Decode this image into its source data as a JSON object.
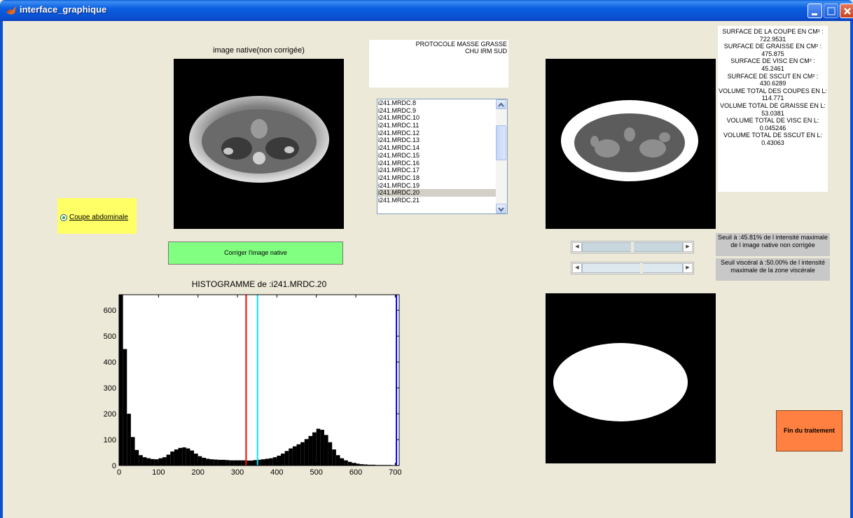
{
  "window": {
    "title": "interface_graphique"
  },
  "native_image": {
    "caption": "image native(non corrigée)"
  },
  "protocol": {
    "line1": "PROTOCOLE MASSE GRASSE",
    "line2": "CHU IRM SUD"
  },
  "file_list": {
    "items": [
      "i241.MRDC.8",
      "i241.MRDC.9",
      "i241.MRDC.10",
      "i241.MRDC.11",
      "i241.MRDC.12",
      "i241.MRDC.13",
      "i241.MRDC.14",
      "i241.MRDC.15",
      "i241.MRDC.16",
      "i241.MRDC.17",
      "i241.MRDC.18",
      "i241.MRDC.19",
      "i241.MRDC.20",
      "i241.MRDC.21"
    ],
    "selected": "i241.MRDC.20"
  },
  "radio": {
    "label": "Coupe abdominale",
    "checked": true
  },
  "correct_button": {
    "label": "Corriger l'image native"
  },
  "stats": {
    "lines": [
      "SURFACE DE LA COUPE EN CM² :",
      "722.9531",
      "SURFACE DE GRAISSE EN CM² :",
      "475.875",
      "SURFACE DE VISC EN CM² :",
      "45.2461",
      "SURFACE DE SSCUT EN CM² :",
      "430.6289",
      "VOLUME TOTAL DES COUPES EN L:",
      "114.771",
      "VOLUME TOTAL DE GRAISSE EN L:",
      "53.0381",
      "VOLUME TOTAL DE VISC EN L:",
      "0.045246",
      "VOLUME TOTAL DE SSCUT EN L:",
      "0.43063"
    ]
  },
  "thresholds": {
    "seuil1": "Seuil à :45.81% de l intensité maximale de l image native non corrigée",
    "seuil2": "Seuil viscéral à :50.00% de l intensité maximale de la zone viscérale",
    "slider1_value": 0.5,
    "slider2_value": 0.59
  },
  "finish_button": {
    "label": "Fin du traitement"
  },
  "chart_data": {
    "type": "bar",
    "title": "HISTOGRAMME de :i241.MRDC.20",
    "xlabel": "",
    "ylabel": "",
    "xlim": [
      0,
      710
    ],
    "ylim": [
      0,
      660
    ],
    "xticks": [
      0,
      100,
      200,
      300,
      400,
      500,
      600,
      700
    ],
    "yticks": [
      0,
      100,
      200,
      300,
      400,
      500,
      600
    ],
    "bin_width": 10,
    "x": [
      0,
      10,
      20,
      30,
      40,
      50,
      60,
      70,
      80,
      90,
      100,
      110,
      120,
      130,
      140,
      150,
      160,
      170,
      180,
      190,
      200,
      210,
      220,
      230,
      240,
      250,
      260,
      270,
      280,
      290,
      300,
      310,
      320,
      330,
      340,
      350,
      360,
      370,
      380,
      390,
      400,
      410,
      420,
      430,
      440,
      450,
      460,
      470,
      480,
      490,
      500,
      510,
      520,
      530,
      540,
      550,
      560,
      570,
      580,
      590,
      600,
      610,
      620,
      630,
      640,
      650,
      660,
      670,
      680,
      690,
      700
    ],
    "values": [
      660,
      450,
      200,
      110,
      60,
      40,
      32,
      28,
      25,
      24,
      28,
      32,
      42,
      54,
      62,
      68,
      70,
      66,
      58,
      46,
      36,
      30,
      26,
      24,
      23,
      22,
      22,
      21,
      20,
      20,
      20,
      20,
      19,
      19,
      21,
      22,
      24,
      26,
      28,
      32,
      38,
      46,
      56,
      66,
      74,
      82,
      90,
      102,
      114,
      128,
      142,
      138,
      118,
      90,
      62,
      40,
      28,
      20,
      14,
      10,
      7,
      5,
      4,
      3,
      3,
      2,
      2,
      2,
      2,
      1,
      1
    ],
    "threshold_lines": [
      {
        "x": 322,
        "color": "#ff0000"
      },
      {
        "x": 351,
        "color": "#00e5ff"
      },
      {
        "x": 703,
        "color": "#0000ff"
      }
    ]
  },
  "colors": {
    "title_bar": "#0a5fd8",
    "correct_button_bg": "#80ff80",
    "radio_panel_bg": "#ffff66",
    "finish_button_bg": "#ff8040",
    "seuil_bg": "#c8c8c8"
  }
}
